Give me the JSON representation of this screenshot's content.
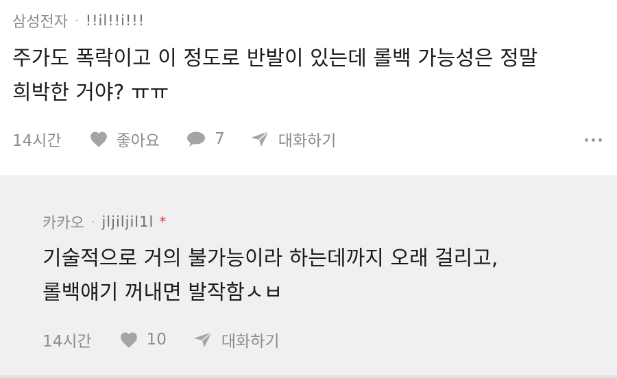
{
  "comment": {
    "author": "삼성전자",
    "separator": "·",
    "nickname": "!!il!!i!!!",
    "text_line1": "주가도 폭락이고 이 정도로 반발이 있는데 롤백 가능성은 정말",
    "text_line2": "희박한 거야? ㅠㅠ",
    "time": "14시간",
    "like_label": "좋아요",
    "reply_count": "7",
    "share_label": "대화하기"
  },
  "reply": {
    "author": "카카오",
    "separator": "·",
    "nickname": "jljiljil1l",
    "star": "*",
    "text_line1": "기술적으로 거의 불가능이라 하는데까지 오래 걸리고,",
    "text_line2": "롤백얘기 꺼내면 발작함ㅅㅂ",
    "time": "14시간",
    "like_count": "10",
    "share_label": "대화하기"
  },
  "icons": {
    "like": "heart-icon",
    "reply": "speech-bubble-icon",
    "share": "paper-plane-icon",
    "more": "more-dots-icon"
  },
  "colors": {
    "reply_background": "#f0f0f2",
    "star": "#d9302c",
    "meta_text": "#8a8a8a"
  }
}
